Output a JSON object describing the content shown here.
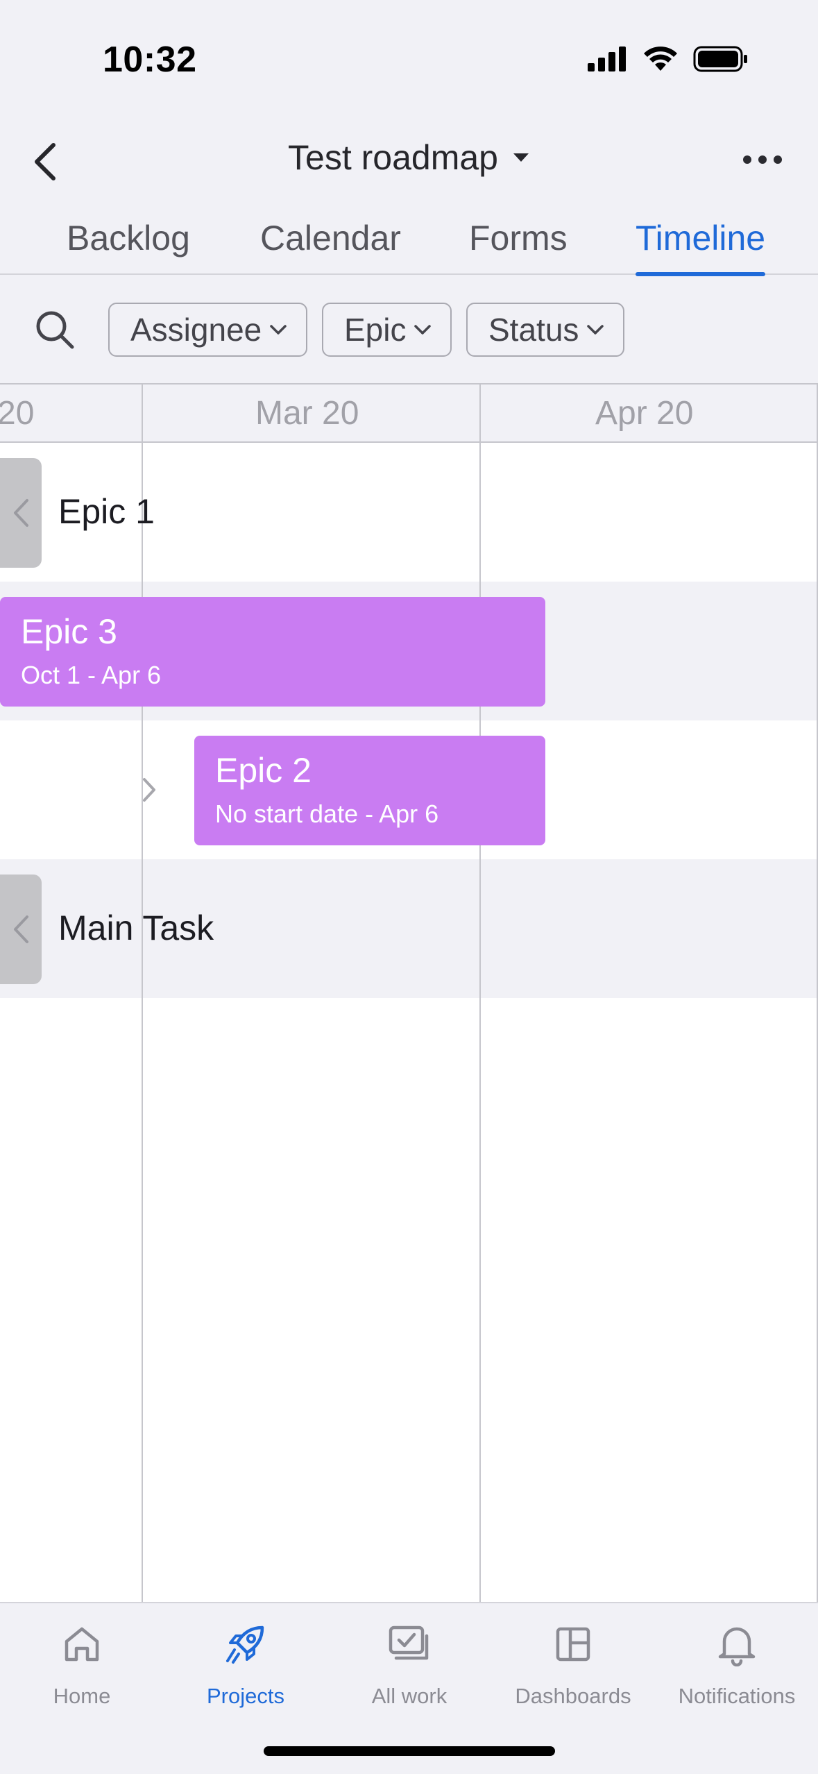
{
  "status_bar": {
    "time": "10:32"
  },
  "header": {
    "title": "Test roadmap"
  },
  "tabs": [
    {
      "label": "Backlog"
    },
    {
      "label": "Calendar"
    },
    {
      "label": "Forms"
    },
    {
      "label": "Timeline",
      "active": true
    }
  ],
  "filters": {
    "chips": [
      {
        "label": "Assignee"
      },
      {
        "label": "Epic"
      },
      {
        "label": "Status"
      }
    ]
  },
  "timeline": {
    "months": [
      "20",
      "Mar 20",
      "Apr 20"
    ],
    "rows": [
      {
        "title": "Epic 1",
        "type": "collapsed"
      },
      {
        "title": "Epic 3",
        "dates": "Oct 1 - Apr 6",
        "type": "bar"
      },
      {
        "title": "Epic 2",
        "dates": "No start date - Apr 6",
        "type": "bar"
      },
      {
        "title": "Main Task",
        "type": "collapsed"
      }
    ],
    "bar_color": "#c97cf2"
  },
  "tabbar": {
    "items": [
      {
        "label": "Home",
        "icon": "home-icon"
      },
      {
        "label": "Projects",
        "icon": "rocket-icon",
        "active": true
      },
      {
        "label": "All work",
        "icon": "all-work-icon"
      },
      {
        "label": "Dashboards",
        "icon": "dashboard-icon"
      },
      {
        "label": "Notifications",
        "icon": "bell-icon"
      }
    ]
  },
  "colors": {
    "accent": "#1f6ad8",
    "epic": "#c97cf2"
  }
}
